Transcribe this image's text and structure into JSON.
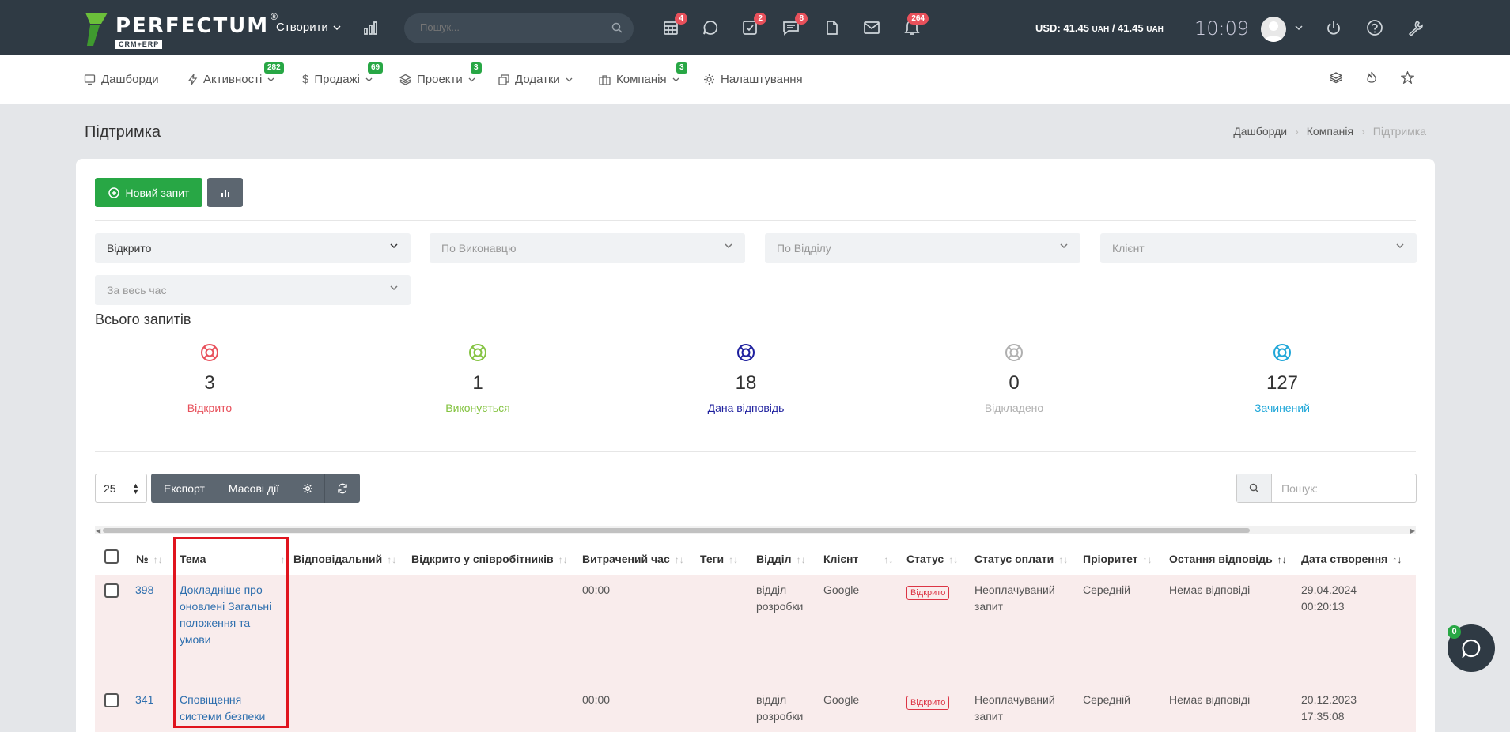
{
  "topbar": {
    "logo_name": "PERFECTUM",
    "logo_sub": "CRM+ERP",
    "logo_reg": "®",
    "create_label": "Створити",
    "search_placeholder": "Пошук...",
    "badges": {
      "calendar": "4",
      "tasks": "2",
      "messages": "8",
      "notifications": "264"
    },
    "currency": "USD: 41.45",
    "currency_unit": "UAH",
    "currency_sep": " / 41.45",
    "time": "10:09"
  },
  "nav": {
    "items": [
      {
        "label": "Дашборди",
        "badge": ""
      },
      {
        "label": "Активності",
        "badge": "282"
      },
      {
        "label": "Продажі",
        "badge": "69"
      },
      {
        "label": "Проекти",
        "badge": "3"
      },
      {
        "label": "Додатки",
        "badge": ""
      },
      {
        "label": "Компанія",
        "badge": "3"
      },
      {
        "label": "Налаштування",
        "badge": ""
      }
    ]
  },
  "page": {
    "title": "Підтримка",
    "breadcrumb": [
      "Дашборди",
      "Компанія",
      "Підтримка"
    ]
  },
  "actions": {
    "new_request": "Новий запит"
  },
  "filters": {
    "status": "Відкрито",
    "assignee": "По Виконавцю",
    "department": "По Відділу",
    "client": "Клієнт",
    "period": "За весь час"
  },
  "stats": {
    "title": "Всього запитів",
    "items": [
      {
        "value": "3",
        "label": "Відкрито",
        "color": "#e8505b"
      },
      {
        "value": "1",
        "label": "Виконується",
        "color": "#84c341"
      },
      {
        "value": "18",
        "label": "Дана відповідь",
        "color": "#1d1f9e"
      },
      {
        "value": "0",
        "label": "Відкладено",
        "color": "#b0b0b0"
      },
      {
        "value": "127",
        "label": "Зачинений",
        "color": "#1ea6d8"
      }
    ]
  },
  "toolbar": {
    "page_size": "25",
    "export": "Експорт",
    "bulk": "Масові дії",
    "search_placeholder": "Пошук:"
  },
  "table": {
    "headers": [
      "№",
      "Тема",
      "Відповідальний",
      "Відкрито у співробітників",
      "Витрачений час",
      "Теги",
      "Відділ",
      "Клієнт",
      "Статус",
      "Статус оплати",
      "Пріоритет",
      "Остання відповідь",
      "Дата створення"
    ],
    "rows": [
      {
        "id": "398",
        "subject": [
          "Докладніше про",
          "оновлені Загальні",
          "положення та",
          "умови"
        ],
        "time": "00:00",
        "dept": [
          "відділ",
          "розробки"
        ],
        "client": "Google",
        "status": "Відкрито",
        "payment": [
          "Неоплачуваний",
          "запит"
        ],
        "priority": "Середній",
        "last_reply": "Немає відповіді",
        "created": [
          "29.04.2024",
          "00:20:13"
        ]
      },
      {
        "id": "341",
        "subject": [
          "Сповіщення",
          "системи безпеки"
        ],
        "time": "00:00",
        "dept": [
          "відділ",
          "розробки"
        ],
        "client": "Google",
        "status": "Відкрито",
        "payment": [
          "Неоплачуваний",
          "запит"
        ],
        "priority": "Середній",
        "last_reply": "Немає відповіді",
        "created": [
          "20.12.2023",
          "17:35:08"
        ]
      }
    ]
  },
  "chat": {
    "badge": "0"
  }
}
